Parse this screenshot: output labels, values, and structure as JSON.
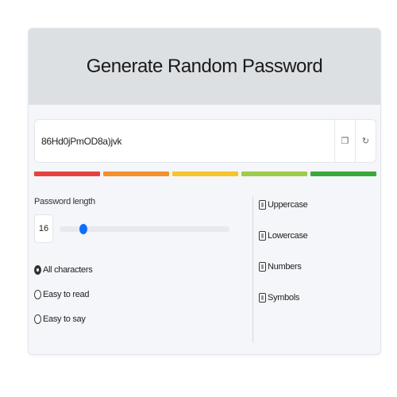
{
  "header": {
    "title": "Generate Random Password"
  },
  "password": {
    "value": "86Hd0jPmOD8a)jvk",
    "copy_icon": "copy-icon",
    "refresh_icon": "refresh-icon"
  },
  "strength_colors": [
    "#e8413d",
    "#f5902a",
    "#f7c52a",
    "#9ccc4a",
    "#3aa93b"
  ],
  "length": {
    "label": "Password length",
    "value": "16",
    "slider_fraction": 0.14,
    "accent": "#0d6efd"
  },
  "modes": [
    {
      "label": "All characters",
      "checked": true
    },
    {
      "label": "Easy to read",
      "checked": false
    },
    {
      "label": "Easy to say",
      "checked": false
    }
  ],
  "options": [
    {
      "label": "Uppercase"
    },
    {
      "label": "Lowercase"
    },
    {
      "label": "Numbers"
    },
    {
      "label": "Symbols"
    }
  ]
}
